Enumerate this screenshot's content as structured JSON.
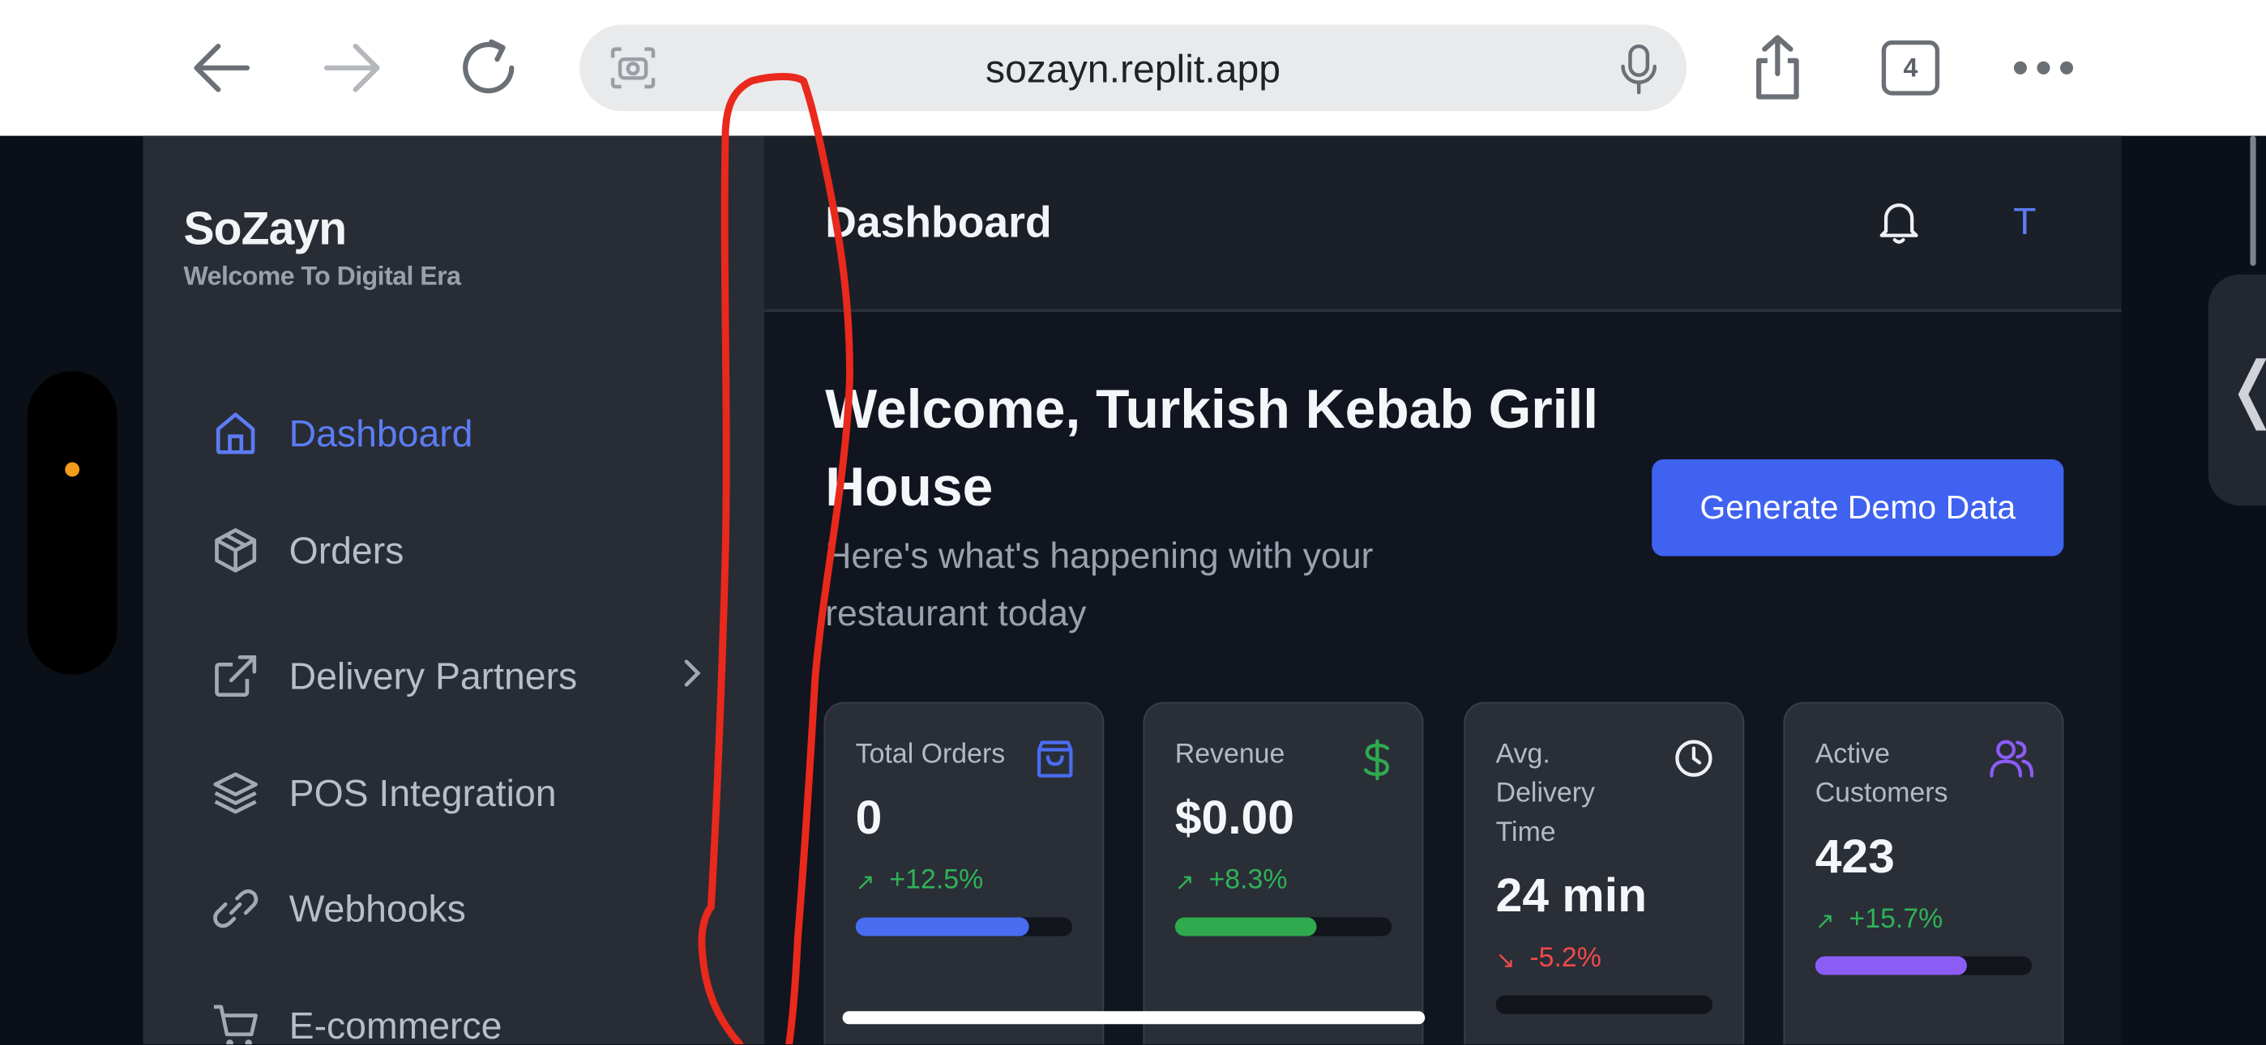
{
  "browser": {
    "url": "sozayn.replit.app",
    "tab_count": "4"
  },
  "sidebar": {
    "brand_title": "SoZayn",
    "brand_subtitle": "Welcome To Digital Era",
    "items": [
      {
        "label": "Dashboard",
        "icon": "home-icon",
        "active": true
      },
      {
        "label": "Orders",
        "icon": "package-icon"
      },
      {
        "label": "Delivery Partners",
        "icon": "external-link-icon",
        "has_submenu": true
      },
      {
        "label": "POS Integration",
        "icon": "layers-icon"
      },
      {
        "label": "Webhooks",
        "icon": "link-icon"
      },
      {
        "label": "E-commerce",
        "icon": "cart-icon"
      }
    ]
  },
  "header": {
    "title": "Dashboard",
    "avatar_initial": "T"
  },
  "welcome": {
    "title": "Welcome, Turkish Kebab Grill House",
    "subtitle": "Here's what's happening with your restaurant today",
    "demo_button": "Generate Demo Data"
  },
  "stats": [
    {
      "label": "Total Orders",
      "value": "0",
      "change": "+12.5%",
      "trend": "up",
      "progress": 0.8,
      "icon": "shopping-bag-icon",
      "color": "#4a6cf0"
    },
    {
      "label": "Revenue",
      "value": "$0.00",
      "change": "+8.3%",
      "trend": "up",
      "progress": 0.65,
      "icon": "dollar-icon",
      "color": "#2faa4f"
    },
    {
      "label": "Avg. Delivery Time",
      "value": "24 min",
      "change": "-5.2%",
      "trend": "down",
      "progress": 0.0,
      "icon": "clock-icon",
      "color": "#ef4a4a"
    },
    {
      "label": "Active Customers",
      "value": "423",
      "change": "+15.7%",
      "trend": "up",
      "progress": 0.7,
      "icon": "users-icon",
      "color": "#8b5cf6"
    }
  ],
  "colors": {
    "accent": "#4a6cf0",
    "success": "#2faa4f",
    "danger": "#ef4a4a",
    "purple": "#8b5cf6",
    "annotation": "#e8291c"
  }
}
